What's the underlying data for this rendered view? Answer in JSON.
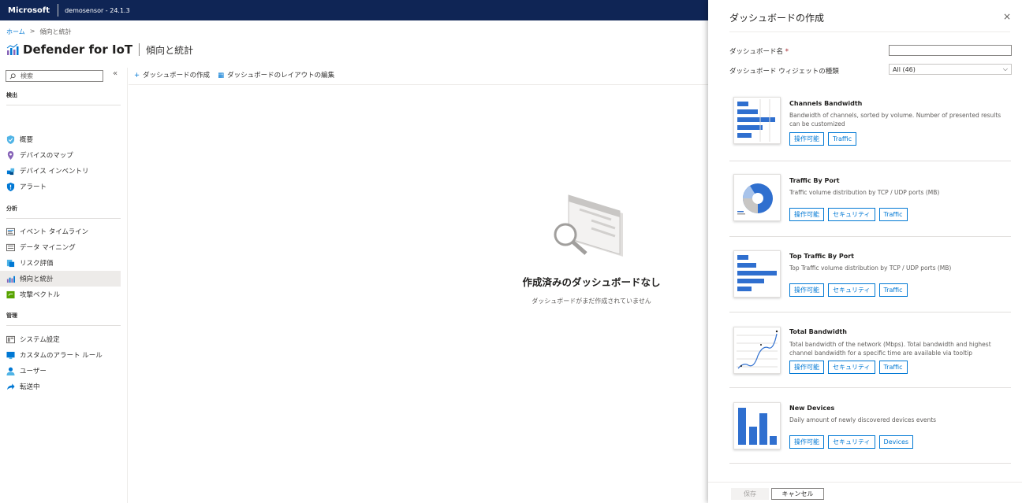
{
  "topbar": {
    "brand": "Microsoft",
    "sensor": "demosensor - 24.1.3"
  },
  "breadcrumb": {
    "home": "ホーム",
    "separator": ">",
    "current": "傾向と統計"
  },
  "page": {
    "title": "Defender for IoT",
    "subtitle": "傾向と統計"
  },
  "sidebar": {
    "search_placeholder": "検索",
    "collapse": "«",
    "sections": [
      {
        "label": "検出"
      },
      {
        "label": "分析"
      },
      {
        "label": "管理"
      }
    ],
    "items": [
      {
        "label": "概要",
        "icon": "shield-icon",
        "color": "#50b4e6"
      },
      {
        "label": "デバイスのマップ",
        "icon": "map-pin-icon",
        "color": "#8764b8"
      },
      {
        "label": "デバイス インベントリ",
        "icon": "cubes-icon",
        "color": "#0078d4"
      },
      {
        "label": "アラート",
        "icon": "alert-shield-icon",
        "color": "#0078d4"
      },
      {
        "label": "イベント タイムライン",
        "icon": "timeline-icon",
        "color": "#605e5c"
      },
      {
        "label": "データ マイニング",
        "icon": "data-mining-icon",
        "color": "#605e5c"
      },
      {
        "label": "リスク評価",
        "icon": "risk-icon",
        "color": "#0078d4"
      },
      {
        "label": "傾向と統計",
        "icon": "trends-icon",
        "color": "#8764b8"
      },
      {
        "label": "攻撃ベクトル",
        "icon": "attack-vector-icon",
        "color": "#57a300"
      },
      {
        "label": "システム設定",
        "icon": "settings-icon",
        "color": "#605e5c"
      },
      {
        "label": "カスタムのアラート ルール",
        "icon": "custom-alert-icon",
        "color": "#0078d4"
      },
      {
        "label": "ユーザー",
        "icon": "user-icon",
        "color": "#0078d4"
      },
      {
        "label": "転送中",
        "icon": "forward-icon",
        "color": "#0078d4"
      }
    ]
  },
  "commands": {
    "create": "ダッシュボードの作成",
    "edit_layout": "ダッシュボードのレイアウトの編集"
  },
  "empty_state": {
    "heading": "作成済みのダッシュボードなし",
    "message": "ダッシュボードがまだ作成されていません"
  },
  "panel": {
    "title": "ダッシュボードの作成",
    "close": "×",
    "name_label": "ダッシュボード名",
    "required_mark": "*",
    "type_label": "ダッシュボード ウィジェットの種類",
    "type_value": "All (46)",
    "widgets": [
      {
        "name": "Channels Bandwidth",
        "desc": "Bandwidth of channels, sorted by volume. Number of presented results can be customized",
        "tags": [
          "操作可能",
          "Traffic"
        ]
      },
      {
        "name": "Traffic By Port",
        "desc": "Traffic volume distribution by TCP / UDP ports (MB)",
        "tags": [
          "操作可能",
          "セキュリティ",
          "Traffic"
        ]
      },
      {
        "name": "Top Traffic By Port",
        "desc": "Top Traffic volume distribution by TCP / UDP ports (MB)",
        "tags": [
          "操作可能",
          "セキュリティ",
          "Traffic"
        ]
      },
      {
        "name": "Total Bandwidth",
        "desc": "Total bandwidth of the network (Mbps). Total bandwidth and highest channel bandwidth for a specific time are available via tooltip",
        "tags": [
          "操作可能",
          "セキュリティ",
          "Traffic"
        ]
      },
      {
        "name": "New Devices",
        "desc": "Daily amount of newly discovered devices events",
        "tags": [
          "操作可能",
          "セキュリティ",
          "Devices"
        ]
      }
    ],
    "save": "保存",
    "cancel": "キャンセル"
  },
  "colors": {
    "accent": "#0078d4",
    "topbar": "#0f2555",
    "chart_blue": "#2f6fcf"
  }
}
